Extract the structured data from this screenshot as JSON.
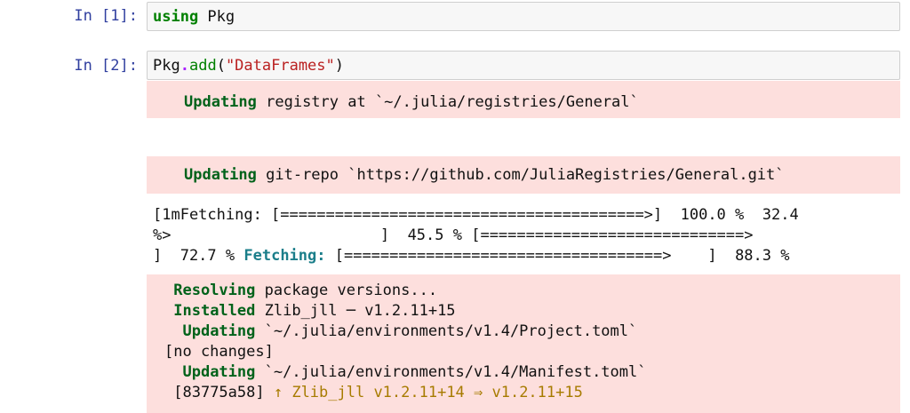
{
  "cells": [
    {
      "prompt": "In [1]:",
      "code": {
        "kw": "using",
        "rest": " Pkg"
      }
    },
    {
      "prompt": "In [2]:",
      "code": {
        "obj": "Pkg",
        "dot": ".",
        "fn": "add",
        "open": "(",
        "str": "\"DataFrames\"",
        "close": ")"
      }
    }
  ],
  "stderr_1": {
    "verb": "Updating",
    "text": " registry at `~/.julia/registries/General`"
  },
  "stderr_2": {
    "verb": "Updating",
    "text": " git-repo `https://github.com/JuliaRegistries/General.git`"
  },
  "progress": {
    "line1": "[1mFetching: [========================================>]  100.0 %  32.4",
    "line2": "%>                       ]  45.5 % [=============================>",
    "line3_a": "]  72.7 %",
    "line3_fetch": "Fetching:",
    "line3_b": " [===================================>    ]  88.3 %"
  },
  "stderr_3": {
    "resolving_verb": "Resolving",
    "resolving_text": " package versions...",
    "installed_verb": "Installed",
    "installed_text": " Zlib_jll ─ v1.2.11+15",
    "updating1_verb": "Updating",
    "updating1_text": " `~/.julia/environments/v1.4/Project.toml`",
    "no_changes": "[no changes]",
    "updating2_verb": "Updating",
    "updating2_text": " `~/.julia/environments/v1.4/Manifest.toml`",
    "hash": "[83775a58]",
    "change": "↑ Zlib_jll v1.2.11+14 ⇒ v1.2.11+15"
  }
}
